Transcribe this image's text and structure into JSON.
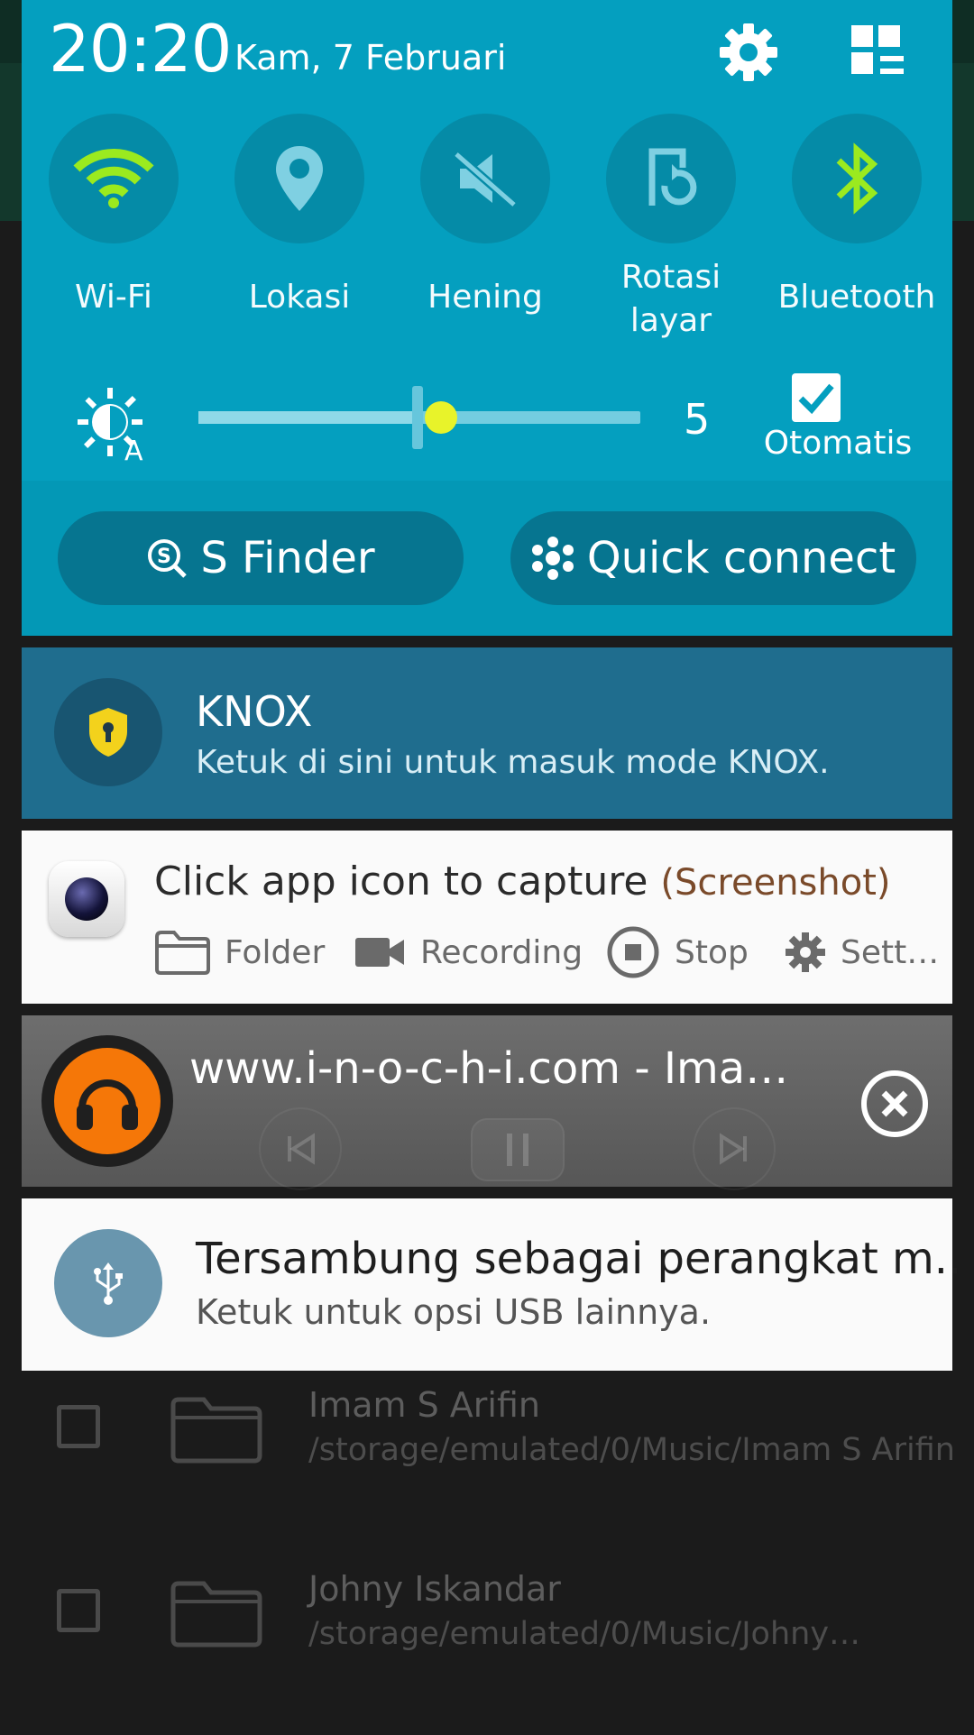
{
  "status": {
    "time": "20:20",
    "date": "Kam, 7 Februari"
  },
  "quick_settings": {
    "tiles": [
      {
        "label": "Wi-Fi",
        "icon": "wifi-icon",
        "active": true
      },
      {
        "label": "Lokasi",
        "icon": "location-icon",
        "active": false
      },
      {
        "label": "Hening",
        "icon": "mute-icon",
        "active": false
      },
      {
        "label": "Rotasi layar",
        "icon": "screen-rotation-icon",
        "active": false
      },
      {
        "label": "Bluetooth",
        "icon": "bluetooth-icon",
        "active": true
      }
    ],
    "brightness": {
      "value": "5",
      "level_fraction": 0.5,
      "auto_label": "Otomatis",
      "auto_checked": true
    },
    "s_finder_label": "S Finder",
    "quick_connect_label": "Quick connect"
  },
  "notifications": {
    "knox": {
      "title": "KNOX",
      "subtitle": "Ketuk di sini untuk masuk mode KNOX."
    },
    "capture": {
      "title": "Click app icon to capture",
      "app_name": "(Screenshot)",
      "actions": [
        "Folder",
        "Recording",
        "Stop",
        "Sett…"
      ]
    },
    "music": {
      "title": "www.i-n-o-c-h-i.com - Ima…"
    },
    "usb": {
      "title": "Tersambung sebagai perangkat m..",
      "subtitle": "Ketuk untuk opsi USB lainnya."
    }
  },
  "background_list": [
    {
      "name": "Imam S Arifin",
      "path": "/storage/emulated/0/Music/Imam S Arifin"
    },
    {
      "name": "Johny Iskandar",
      "path": "/storage/emulated/0/Music/Johny…"
    }
  ],
  "colors": {
    "panel": "#049fbf",
    "tile": "#058ba7",
    "active_icon": "#9bea1f",
    "knox": "#1f6d8e",
    "slider_thumb": "#e8f32a"
  }
}
